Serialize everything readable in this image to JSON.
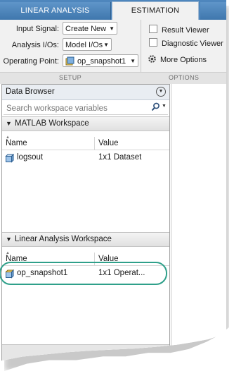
{
  "tabs": [
    {
      "label": "LINEAR ANALYSIS"
    },
    {
      "label": "ESTIMATION"
    }
  ],
  "setup": {
    "input_signal_label": "Input Signal:",
    "input_signal_value": "Create New",
    "analysis_ios_label": "Analysis I/Os:",
    "analysis_ios_value": "Model I/Os",
    "operating_point_label": "Operating Point:",
    "operating_point_value": "op_snapshot1",
    "section_label": "SETUP"
  },
  "options": {
    "result_viewer_label": "Result Viewer",
    "diagnostic_viewer_label": "Diagnostic Viewer",
    "more_options_label": "More Options",
    "section_label": "OPTIONS"
  },
  "data_browser": {
    "title": "Data Browser",
    "search_placeholder": "Search workspace variables",
    "matlab_workspace": {
      "title": "MATLAB Workspace",
      "col_name": "Name",
      "col_value": "Value",
      "rows": [
        {
          "name": "logsout",
          "value": "1x1 Dataset"
        }
      ]
    },
    "linear_workspace": {
      "title": "Linear Analysis Workspace",
      "col_name": "Name",
      "col_value": "Value",
      "rows": [
        {
          "name": "op_snapshot1",
          "value": "1x1 Operat..."
        }
      ]
    }
  },
  "colors": {
    "tab_bar": "#4e86bd",
    "highlight_ring": "#2fa08a",
    "toolstrip_bg": "#f1f1f1"
  },
  "icons": [
    "search-icon",
    "gear-icon",
    "dataset-icon",
    "operating-point-icon",
    "chevron-down-icon",
    "panel-menu-icon"
  ]
}
